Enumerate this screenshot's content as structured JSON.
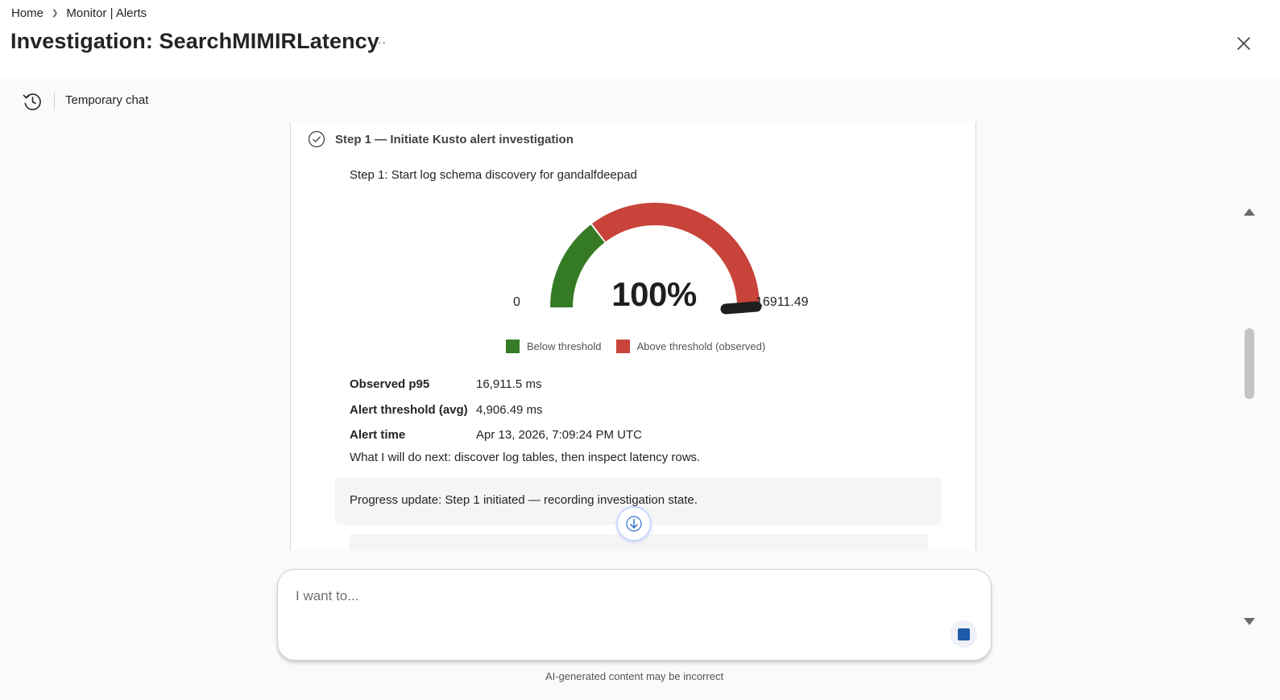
{
  "breadcrumb": {
    "home": "Home",
    "current": "Monitor | Alerts"
  },
  "header": {
    "title": "Investigation: SearchMIMIRLatency",
    "more": "···"
  },
  "toolbar": {
    "temp_chat": "Temporary chat"
  },
  "step": {
    "title": "Step 1 — Initiate Kusto alert investigation",
    "subtitle": "Step 1: Start log schema discovery for gandalfdeepad"
  },
  "gauge": {
    "min_label": "0",
    "max_label": "16911.49",
    "percent_label": "100%",
    "threshold_fraction": 0.29,
    "observed_fraction": 1.0,
    "colors": {
      "below": "#357a24",
      "above": "#c8433a",
      "needle": "#1f1f1f"
    }
  },
  "legend": {
    "below": "Below threshold",
    "above": "Above threshold (observed)"
  },
  "facts": [
    {
      "label": "Observed p95",
      "value": "16,911.5 ms"
    },
    {
      "label": "Alert threshold (avg)",
      "value": "4,906.49 ms"
    },
    {
      "label": "Alert time",
      "value": "Apr 13, 2026, 7:09:24 PM UTC"
    }
  ],
  "next_text": "What I will do next: discover log tables, then inspect latency rows.",
  "progress_text": "Progress update: Step 1 initiated — recording investigation state.",
  "composer": {
    "placeholder": "I want to..."
  },
  "disclaimer": "AI-generated content may be incorrect"
}
